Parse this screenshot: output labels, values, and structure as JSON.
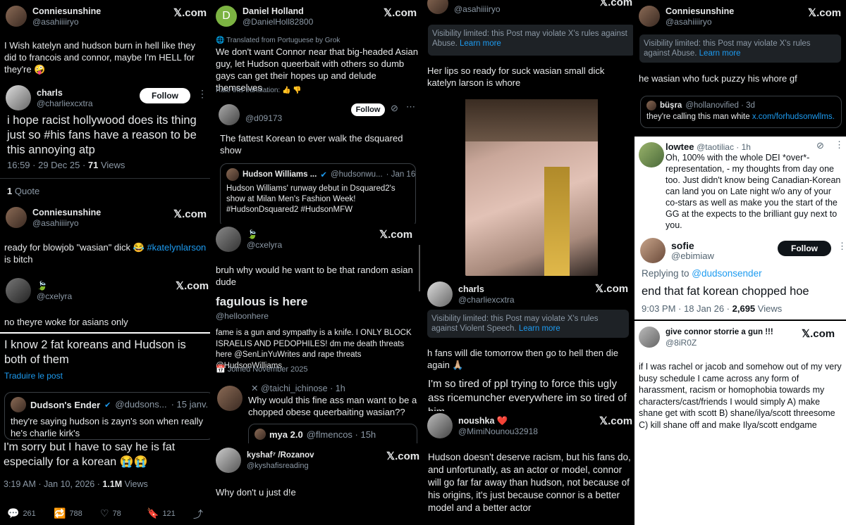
{
  "brand": {
    "x_logo": "𝕏.com"
  },
  "c1": {
    "p1": {
      "name": "Conniesunshine",
      "handle": "@asahiiiiryo",
      "text": "I Wish katelyn and hudson burn in hell like they did to francois and connor, maybe I'm HELL for they're 🤪"
    },
    "p2": {
      "name": "charls",
      "handle": "@charliexcxtra",
      "follow": "Follow",
      "text": "i hope racist hollywood does its thing just so #his fans have a reason to be this annoying atp",
      "meta": "16:59 · 29 Dec 25 · ",
      "views_num": "71",
      "views_label": " Views",
      "quote_num": "1",
      "quote_label": " Quote"
    },
    "p3": {
      "name": "Conniesunshine",
      "handle": "@asahiiiiryo",
      "text": "ready for blowjob \"wasian\" dick 😂 ",
      "tag": "#katelynlarson",
      "text2": "is bitch"
    },
    "p4": {
      "handle": "@cxelyra",
      "text": "no theyre woke for asians only"
    },
    "p5": {
      "text": "I know 2 fat koreans and Hudson is both of them",
      "translate": "Traduire le post",
      "q_name": "Dudson's Ender",
      "q_handle": "@dudsons...",
      "q_date": "· 15 janv.",
      "q_text": "they're saying hudson is zayn's son when really he's charlie kirk's",
      "text2": "I'm sorry but I have to say he is fat especially for a korean 😭😭",
      "meta": "3:19 AM · Jan 10, 2026 · ",
      "views_num": "1.1M",
      "views_label": " Views",
      "replies": "261",
      "reposts": "788",
      "likes": "78",
      "bookmarks": "121"
    }
  },
  "c2": {
    "p1": {
      "name": "Daniel Holland",
      "initial": "D",
      "handle": "@DanielHoll82800",
      "translated": "Translated from Portuguese by Grok",
      "text": "We don't want Connor near that big-headed Asian guy, let Hudson queerbait with others so dumb gays can get their hopes up and delude themselves",
      "rate": "Rate this translation:"
    },
    "p2": {
      "handle": "@d09173",
      "follow": "Follow",
      "text": "The fattest Korean to ever walk the dsquared show",
      "q_name": "Hudson Williams ...",
      "q_handle": "@hudsonwu...",
      "q_date": "· Jan 16",
      "q_text": "Hudson Williams' runway debut in Dsquared2's show at Milan Men's Fashion Week! #HudsonDsquared2 #HudsonMFW"
    },
    "p3": {
      "handle": "@cxelyra",
      "text": "bruh why would he want to be that random asian dude"
    },
    "p4": {
      "name": "fagulous is here",
      "handle": "@helloonhere",
      "bio": "fame is a gun and sympathy is a knife. I ONLY BLOCK ISRAELIS AND PEDOPHILES! dm me death threats here @SenLinYuWrites and rape threats @HudsonWilliams",
      "joined": "Joined November 2025"
    },
    "p5": {
      "handle": "@taichi_ichinose · 1h",
      "text": "Why would this fine ass man want to be a chopped obese queerbaiting wasian??",
      "q_name": "mya 2.0",
      "q_handle": "@flmencos · 15h"
    },
    "p6": {
      "name": "kyshaf⁷ /Rozanov",
      "handle": "@kyshafisreading",
      "text": "Why don't u just d!e"
    }
  },
  "c3": {
    "p1": {
      "handle": "@asahiiiiryo",
      "vis": "Visibility limited: this Post may violate X's rules against Abuse.",
      "learn": "Learn more",
      "text": "Her lips so ready for suck wasian small dick  katelyn larson is whore"
    },
    "p2": {
      "name": "charls",
      "handle": "@charliexcxtra",
      "vis": "Visibility limited: this Post may violate X's rules against Violent Speech.",
      "learn": "Learn more",
      "text": "h fans will die tomorrow then go to hell then die again 🙏🏼"
    },
    "p3": {
      "text": "I'm so tired of ppl trying to force this ugly ass ricemuncher everywhere im so tired of him"
    },
    "p4": {
      "name": "noushka ❤️",
      "handle": "@MimiNounou32918",
      "text": "Hudson doesn't deserve racism, but his fans do, and unfortunatly, as an actor or model, connor will go far far away than hudson, not because of his origins, it's just because connor is a better model and a better actor"
    }
  },
  "c4": {
    "p1": {
      "name": "Conniesunshine",
      "handle": "@asahiiiiryo",
      "vis": "Visibility limited: this Post may violate X's rules against Abuse.",
      "learn": "Learn more",
      "text": "he wasian who fuck puzzy his whore gf",
      "q_name": "büşra",
      "q_handle": "@hollanovified · 3d",
      "q_text": "they're calling this man white ",
      "q_link": "x.com/forhudsonwllms..."
    },
    "p2": {
      "name": "lowtee",
      "handle": "@taotiliac · 1h",
      "text": "Oh, 100% with the whole DEI *over*-representation, - my thoughts from day one too. Just didn't know being Canadian-Korean can land you on Late night w/o any of your co-stars as well as make you the start of the GG at the expects to the brilliant guy next to you."
    },
    "p3": {
      "name": "sofie",
      "handle": "@ebimiaw",
      "follow": "Follow",
      "reply_label": "Replying to ",
      "reply_to": "@dudsonsender",
      "text": "end that fat korean chopped hoe",
      "meta": "9:03 PM · 18 Jan 26 · ",
      "views_num": "2,695",
      "views_label": " Views"
    },
    "p4": {
      "name": "give connor storrie a gun !!!",
      "handle": "@8iR0Z",
      "text": "if I was rachel or jacob and somehow out of my very busy schedule I came across any form of harassment, racism or homophobia towards my characters/cast/friends I would simply A) make shane get with scott B) shane/ilya/scott threesome C) kill shane off and make Ilya/scott endgame"
    }
  }
}
